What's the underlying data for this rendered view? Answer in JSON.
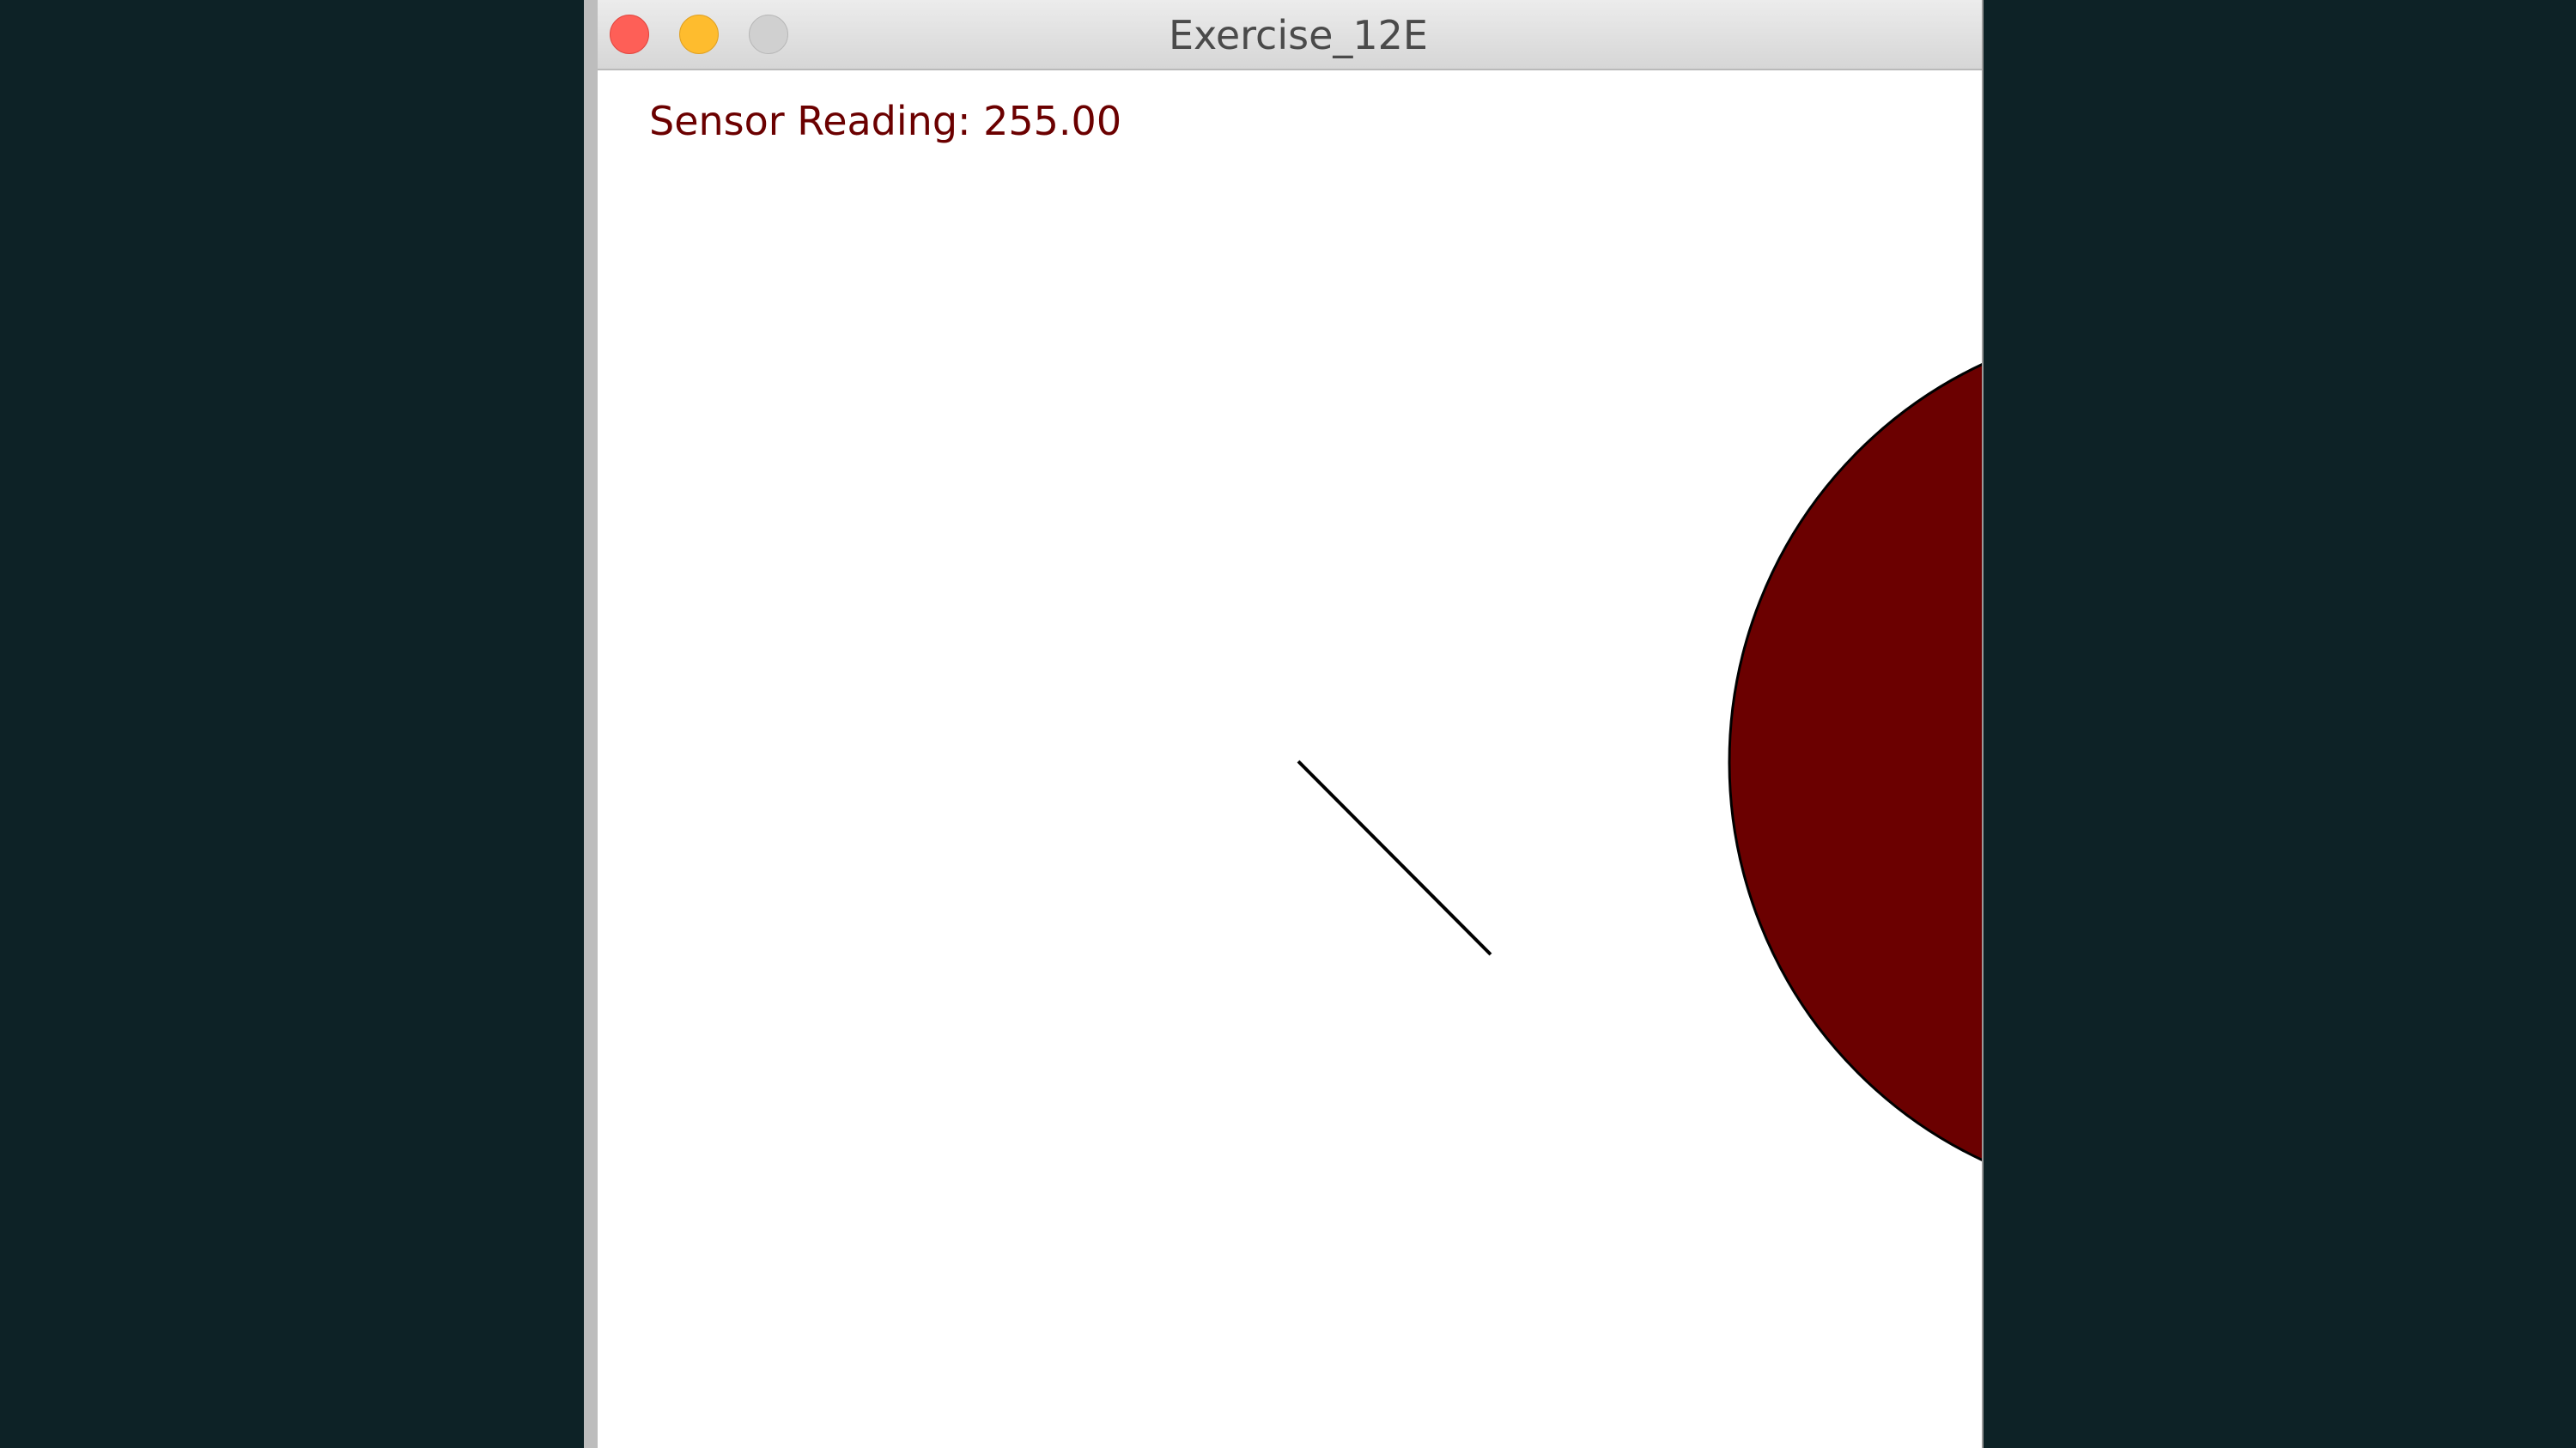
{
  "window": {
    "title": "Exercise_12E"
  },
  "sketch": {
    "sensor_label": "Sensor Reading: 255.00",
    "sensor_value": 255.0,
    "text_color": "#6b0000",
    "circle_color": "#6b0000",
    "line_color": "#000000"
  },
  "desktop": {
    "background_color": "#0d2226"
  }
}
